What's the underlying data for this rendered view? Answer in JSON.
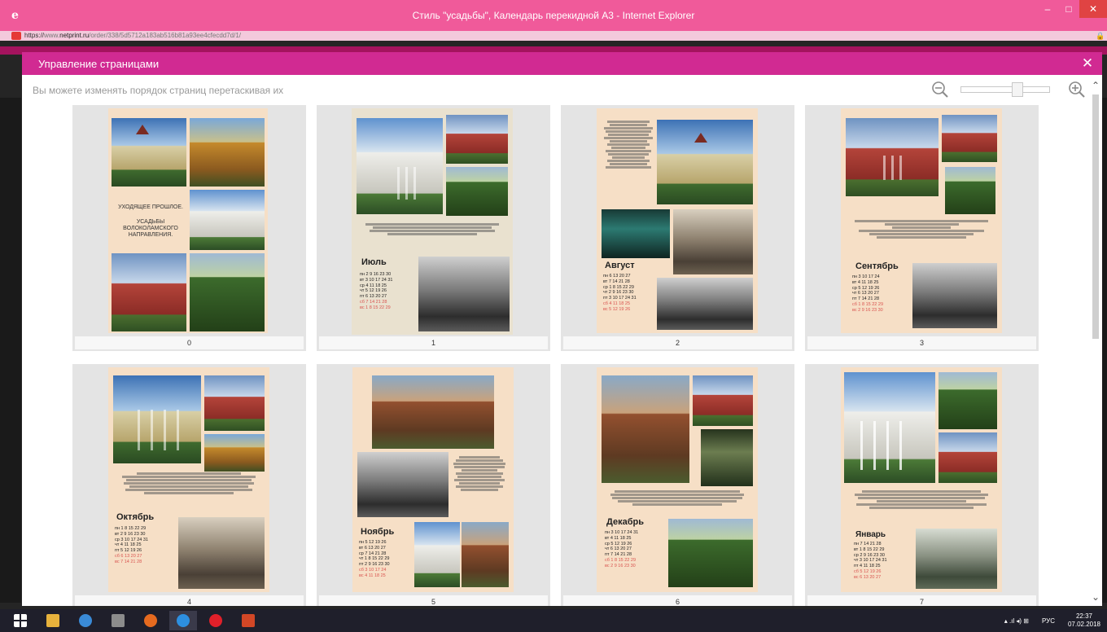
{
  "window": {
    "title": "Стиль \"усадьбы\", Календарь перекидной А3 - Internet Explorer",
    "controls": {
      "minimize": "–",
      "maximize": "□",
      "close": "✕"
    }
  },
  "address_bar": {
    "scheme": "https://",
    "host_prefix": "www.",
    "host": "netprint.ru",
    "path": "/order/338/5d5712a183ab516b81a93ee4cfecdd7d/1/"
  },
  "modal": {
    "title": "Управление страницами",
    "close_icon": "✕",
    "hint": "Вы можете изменять порядок страниц перетаскивая их",
    "zoom": {
      "level": 0.66
    }
  },
  "pages": [
    {
      "number": "0",
      "cover_title": "УХОДЯЩЕЕ ПРОШЛОЕ.",
      "cover_subtitle": "УСАДЬБЫ ВОЛОКОЛАМСКОГО НАПРАВЛЕНИЯ."
    },
    {
      "number": "1",
      "month": "Июль",
      "rows": [
        "пн  2 9 16 23 30",
        "вт  3 10 17 24 31",
        "ср  4 11 18 25",
        "чт  5 12 19 26",
        "пт  6 13 20 27",
        "сб  7 14 21 28",
        "вс  1 8 15 22 29"
      ]
    },
    {
      "number": "2",
      "month": "Август",
      "rows": [
        "пн  6 13 20 27",
        "вт  7 14 21 28",
        "ср 1 8 15 22 29",
        "чт 2 9 16 23 30",
        "пт 3 10 17 24 31",
        "сб 4 11 18 25",
        "вс 5 12 19 26"
      ]
    },
    {
      "number": "3",
      "month": "Сентябрь",
      "rows": [
        "пн  3 10 17 24",
        "вт  4 11 18 25",
        "ср  5 12 19 26",
        "чт  6 13 20 27",
        "пт  7 14 21 28",
        "сб 1 8 15 22 29",
        "вс 2 9 16 23 30"
      ]
    },
    {
      "number": "4",
      "month": "Октябрь",
      "rows": [
        "пн 1 8 15 22 29",
        "вт 2 9 16 23 30",
        "ср 3 10 17 24 31",
        "чт 4 11 18 25",
        "пт 5 12 19 26",
        "сб 6 13 20 27",
        "вс 7 14 21 28"
      ]
    },
    {
      "number": "5",
      "month": "Ноябрь",
      "rows": [
        "пн  5 12 19 26",
        "вт  6 13 20 27",
        "ср  7 14 21 28",
        "чт 1 8 15 22 29",
        "пт 2 9 16 23 30",
        "сб 3 10 17 24",
        "вс 4 11 18 25"
      ]
    },
    {
      "number": "6",
      "month": "Декабрь",
      "rows": [
        "пн  3 10 17 24 31",
        "вт  4 11 18 25",
        "ср  5 12 19 26",
        "чт  6 13 20 27",
        "пт  7 14 21 28",
        "сб 1 8 15 22 29",
        "вс 2 9 16 23 30"
      ]
    },
    {
      "number": "7",
      "month": "Январь",
      "rows": [
        "пн  7 14 21 28",
        "вт 1 8 15 22 29",
        "ср 2 9 16 23 30",
        "чт 3 10 17 24 31",
        "пт 4 11 18 25",
        "сб 5 12 19 26",
        "вс 6 13 20 27"
      ]
    }
  ],
  "taskbar": {
    "language": "РУС",
    "time": "22:37",
    "date": "07.02.2018",
    "tray_icons": "▴ .ıl ◂) ⊞"
  }
}
